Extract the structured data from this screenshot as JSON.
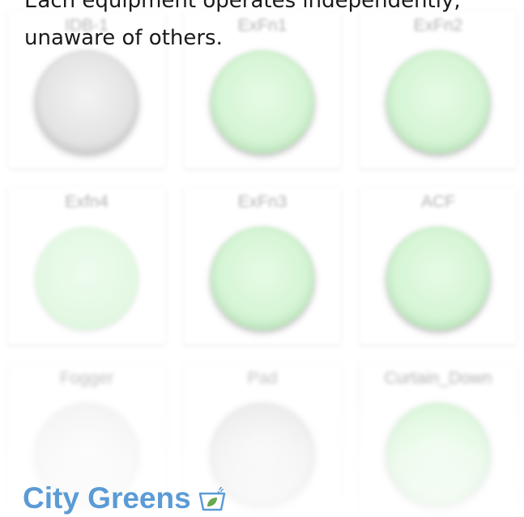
{
  "message": {
    "line1": "Each equipment operates independently,",
    "line2": "unaware of others."
  },
  "tiles": [
    {
      "label": "IDB-1",
      "state": "off"
    },
    {
      "label": "ExFn1",
      "state": "on"
    },
    {
      "label": "ExFn2",
      "state": "on"
    },
    {
      "label": "Exfn4",
      "state": "on"
    },
    {
      "label": "ExFn3",
      "state": "on"
    },
    {
      "label": "ACF",
      "state": "on"
    },
    {
      "label": "Fogger",
      "state": "off"
    },
    {
      "label": "Pad",
      "state": "off"
    },
    {
      "label": "Curtain_Down",
      "state": "on"
    }
  ],
  "brand": {
    "name": "City Greens",
    "icon": "plant-pot-icon",
    "color": "#5b9bd5",
    "accent_green": "#6aa84f"
  },
  "colors": {
    "bulb_on": "#d6f5d6",
    "bulb_off": "#e3e3e3",
    "label": "#b3b3b3"
  }
}
